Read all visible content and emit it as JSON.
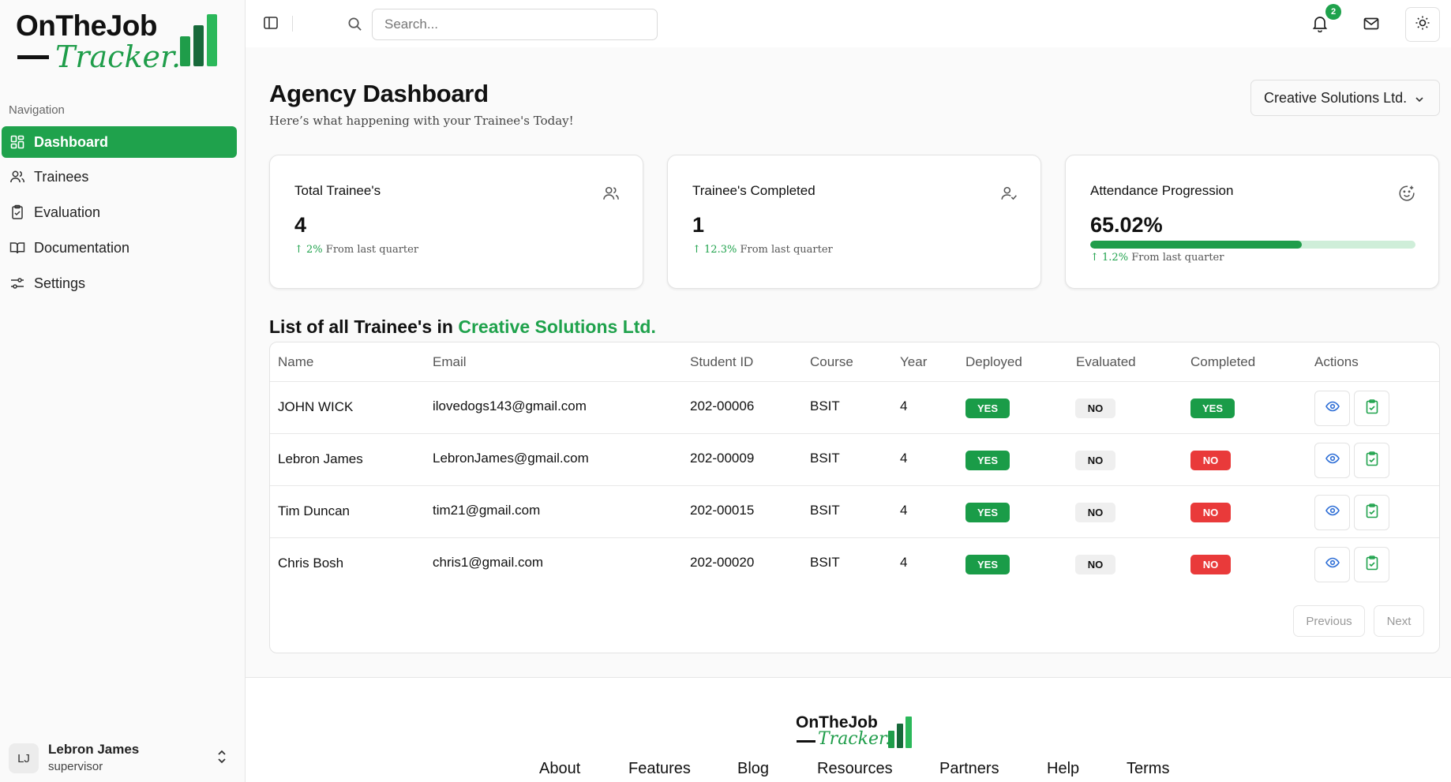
{
  "brand": {
    "line1": "OnTheJob",
    "line2": "Tracker.",
    "accent": "#1fa24c"
  },
  "sidebar": {
    "heading": "Navigation",
    "items": [
      {
        "label": "Dashboard",
        "icon": "grid-icon",
        "active": true
      },
      {
        "label": "Trainees",
        "icon": "users-icon"
      },
      {
        "label": "Evaluation",
        "icon": "clipboard-icon"
      },
      {
        "label": "Documentation",
        "icon": "book-icon"
      },
      {
        "label": "Settings",
        "icon": "sliders-icon"
      }
    ],
    "user": {
      "initials": "LJ",
      "name": "Lebron James",
      "role": "supervisor"
    }
  },
  "topbar": {
    "search_placeholder": "Search...",
    "notifications_count": "2"
  },
  "page": {
    "title": "Agency Dashboard",
    "subtitle": "Here’s what happening with your Trainee's Today!",
    "company": "Creative Solutions Ltd."
  },
  "cards": [
    {
      "title": "Total Trainee's",
      "value": "4",
      "delta": "2%",
      "delta_text": "From last quarter",
      "icon": "users-icon"
    },
    {
      "title": "Trainee's Completed",
      "value": "1",
      "delta": "12.3%",
      "delta_text": "From last quarter",
      "icon": "user-check-icon"
    },
    {
      "title": "Attendance Progression",
      "value": "65.02%",
      "delta": "1.2%",
      "delta_text": "From last quarter",
      "icon": "smile-plus-icon",
      "progress": 0.6502
    }
  ],
  "list": {
    "title_prefix": "List of all Trainee's in",
    "company": "Creative Solutions Ltd.",
    "columns": [
      "Name",
      "Email",
      "Student ID",
      "Course",
      "Year",
      "Deployed",
      "Evaluated",
      "Completed",
      "Actions"
    ],
    "rows": [
      {
        "name": "JOHN WICK",
        "email": "ilovedogs143@gmail.com",
        "id": "202-00006",
        "course": "BSIT",
        "year": "4",
        "deployed": "YES",
        "evaluated": "NO",
        "completed": "YES"
      },
      {
        "name": "Lebron James",
        "email": "LebronJames@gmail.com",
        "id": "202-00009",
        "course": "BSIT",
        "year": "4",
        "deployed": "YES",
        "evaluated": "NO",
        "completed": "NO"
      },
      {
        "name": "Tim Duncan",
        "email": "tim21@gmail.com",
        "id": "202-00015",
        "course": "BSIT",
        "year": "4",
        "deployed": "YES",
        "evaluated": "NO",
        "completed": "NO"
      },
      {
        "name": "Chris Bosh",
        "email": "chris1@gmail.com",
        "id": "202-00020",
        "course": "BSIT",
        "year": "4",
        "deployed": "YES",
        "evaluated": "NO",
        "completed": "NO"
      }
    ],
    "previous_label": "Previous",
    "next_label": "Next"
  },
  "footer": {
    "links": [
      "About",
      "Features",
      "Blog",
      "Resources",
      "Partners",
      "Help",
      "Terms"
    ]
  }
}
